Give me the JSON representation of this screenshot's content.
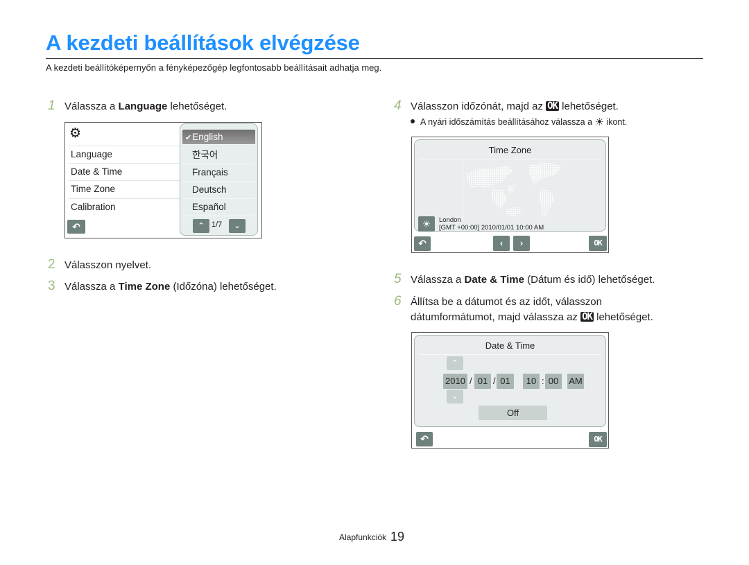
{
  "page": {
    "title": "A kezdeti beállítások elvégzése",
    "intro": "A kezdeti beállítóképernyőn a fényképezőgép legfontosabb beállításait adhatja meg.",
    "accent_color": "#1e90ff",
    "step_number_color": "#9cba7f"
  },
  "steps": [
    {
      "num": "1",
      "pre": "Válassza a ",
      "bold": "Language",
      "post": " lehetőséget."
    },
    {
      "num": "2",
      "text": "Válasszon nyelvet."
    },
    {
      "num": "3",
      "pre": "Válassza a ",
      "bold": "Time Zone",
      "post": " (Időzóna) lehetőséget."
    },
    {
      "num": "4",
      "pre": "Válasszon időzónát, majd az ",
      "ok": "OK",
      "post": " lehetőséget."
    },
    {
      "num": "5",
      "pre": "Válassza a ",
      "bold": "Date & Time",
      "post": " (Dátum és idő) lehetőséget."
    },
    {
      "num": "6",
      "line1": "Állítsa be a dátumot és az időt, válasszon",
      "pre": "dátumformátumot, majd válassza az ",
      "ok": "OK",
      "post": " lehetőséget."
    }
  ],
  "tip": {
    "pre": "A nyári időszámítás beállításához válassza a ",
    "icon": "sun-icon",
    "post": " ikont."
  },
  "screen_language": {
    "settings_icon": "gear-icon",
    "menu_items": [
      "Language",
      "Date & Time",
      "Time Zone",
      "Calibration"
    ],
    "languages": [
      "English",
      "한국어",
      "Français",
      "Deutsch",
      "Español"
    ],
    "selected_language": "English",
    "page_indicator": "1/7",
    "back_icon": "back-icon"
  },
  "screen_timezone": {
    "title": "Time Zone",
    "city": "London",
    "info": "[GMT +00:00] 2010/01/01 10:00 AM",
    "ok_label": "OK"
  },
  "screen_datetime": {
    "title": "Date & Time",
    "year": "2010",
    "month": "01",
    "day": "01",
    "hour": "10",
    "minute": "00",
    "ampm": "AM",
    "date_sep": "/",
    "time_sep": ":",
    "dst": "Off",
    "ok_label": "OK"
  },
  "footer": {
    "section": "Alapfunkciók",
    "page": "19"
  }
}
